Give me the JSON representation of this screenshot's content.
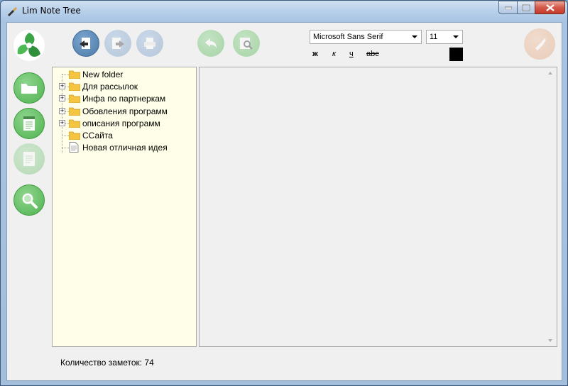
{
  "window": {
    "title": "Lim Note Tree"
  },
  "toolbar": {
    "font_name": "Microsoft Sans Serif",
    "font_size": "11",
    "bold_label": "ж",
    "italic_label": "к",
    "underline_label": "ч",
    "strike_label": "abc",
    "text_color": "#000000"
  },
  "tree": {
    "items": [
      {
        "label": "New folder",
        "type": "folder",
        "expandable": false
      },
      {
        "label": "Для рассылок",
        "type": "folder",
        "expandable": true
      },
      {
        "label": "Инфа по партнеркам",
        "type": "folder",
        "expandable": true
      },
      {
        "label": "Обовления программ",
        "type": "folder",
        "expandable": true
      },
      {
        "label": "описания программ",
        "type": "folder",
        "expandable": true
      },
      {
        "label": "ССайта",
        "type": "folder",
        "expandable": false
      },
      {
        "label": "Новая отличная идея",
        "type": "note",
        "expandable": false
      }
    ]
  },
  "status": {
    "notes_count": "Количество заметок: 74"
  },
  "colors": {
    "accent_green": "#5fbf63",
    "accent_blue": "#4f7fae",
    "tree_bg": "#ffffe9"
  }
}
